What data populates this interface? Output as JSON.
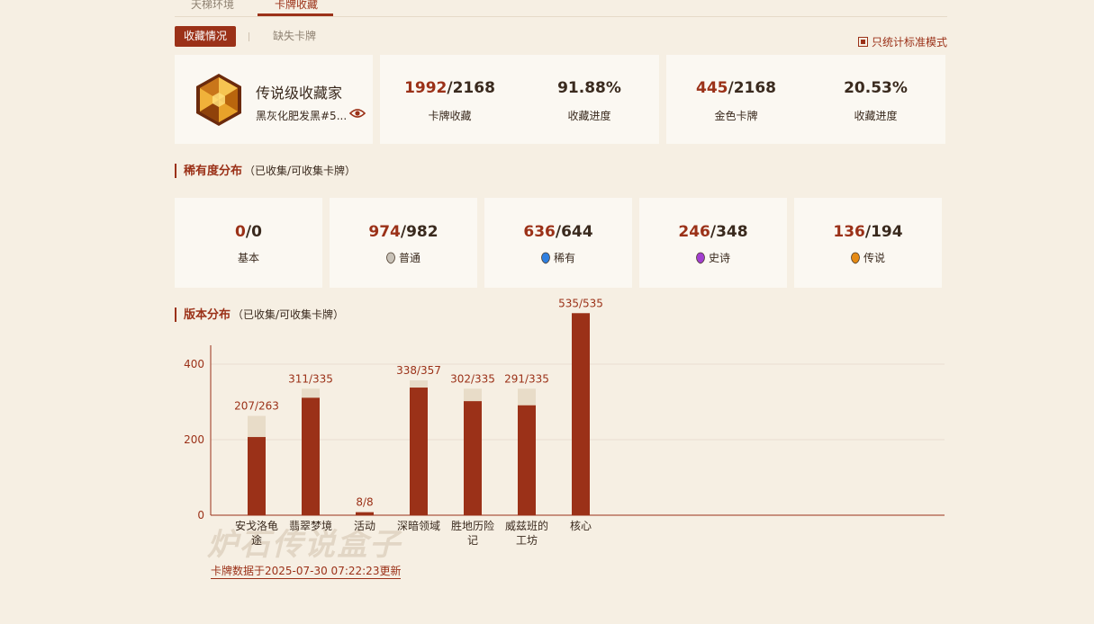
{
  "top_tabs": [
    {
      "label": "天梯环境"
    },
    {
      "label": "卡牌收藏"
    }
  ],
  "sub_tabs": {
    "active": "收藏情况",
    "other": "缺失卡牌",
    "standard_only": "只统计标准模式"
  },
  "profile": {
    "title": "传说级收藏家",
    "name": "黑灰化肥发黑#5..."
  },
  "summary": [
    {
      "collected": "1992",
      "total": "/2168",
      "label": "卡牌收藏"
    },
    {
      "value": "91.88%",
      "label": "收藏进度"
    },
    {
      "collected": "445",
      "total": "/2168",
      "label": "金色卡牌"
    },
    {
      "value": "20.53%",
      "label": "收藏进度"
    }
  ],
  "rarity_section": {
    "title": "稀有度分布",
    "sub": "（已收集/可收集卡牌）"
  },
  "rarity": [
    {
      "collected": "0",
      "total": "/0",
      "label": "基本",
      "gem_color": ""
    },
    {
      "collected": "974",
      "total": "/982",
      "label": "普通",
      "gem_color": "#c8c2b8"
    },
    {
      "collected": "636",
      "total": "/644",
      "label": "稀有",
      "gem_color": "#2f7fe0"
    },
    {
      "collected": "246",
      "total": "/348",
      "label": "史诗",
      "gem_color": "#a23fd0"
    },
    {
      "collected": "136",
      "total": "/194",
      "label": "传说",
      "gem_color": "#e58a14"
    }
  ],
  "version_section": {
    "title": "版本分布",
    "sub": "（已收集/可收集卡牌）"
  },
  "chart_data": {
    "type": "bar",
    "categories": [
      "安戈洛龟途",
      "翡翠梦境",
      "活动",
      "深暗领域",
      "胜地历险记",
      "威兹班的工坊",
      "核心"
    ],
    "category_lines": [
      [
        "安戈洛龟",
        "途"
      ],
      [
        "翡翠梦境"
      ],
      [
        "活动"
      ],
      [
        "深暗领域"
      ],
      [
        "胜地历险",
        "记"
      ],
      [
        "威兹班的",
        "工坊"
      ],
      [
        "核心"
      ]
    ],
    "series": [
      {
        "name": "collected",
        "values": [
          207,
          311,
          8,
          338,
          302,
          291,
          535
        ]
      },
      {
        "name": "total",
        "values": [
          263,
          335,
          8,
          357,
          335,
          335,
          535
        ]
      }
    ],
    "labels": [
      "207/263",
      "311/335",
      "8/8",
      "338/357",
      "302/335",
      "291/335",
      "535/535"
    ],
    "yticks": [
      0,
      200,
      400
    ],
    "ylim": [
      0,
      450
    ],
    "colors": {
      "collected": "#9b3118",
      "total": "#e8dcc8"
    }
  },
  "updated_text": "卡牌数据于2025-07-30 07:22:23更新",
  "watermark": "炉石传说盒子"
}
